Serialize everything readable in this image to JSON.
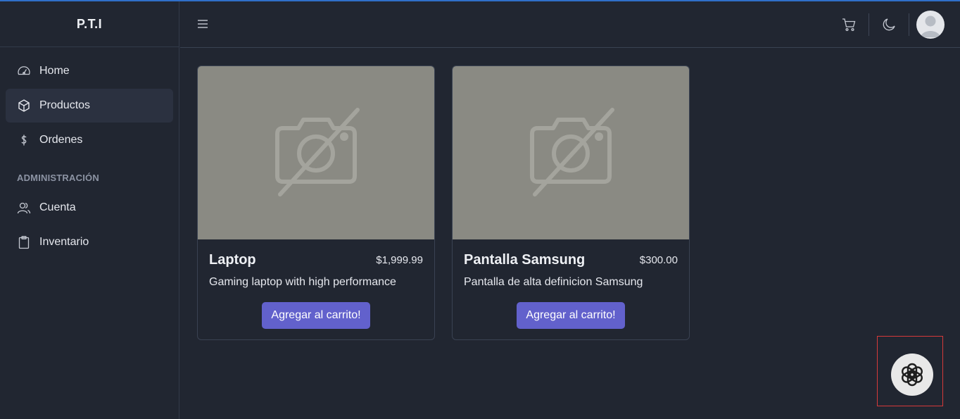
{
  "brand": "P.T.I",
  "sidebar": {
    "items": [
      {
        "label": "Home",
        "icon": "speedometer-icon"
      },
      {
        "label": "Productos",
        "icon": "cube-icon"
      },
      {
        "label": "Ordenes",
        "icon": "dollar-icon"
      }
    ],
    "section_title": "ADMINISTRACIÓN",
    "admin_items": [
      {
        "label": "Cuenta",
        "icon": "people-icon"
      },
      {
        "label": "Inventario",
        "icon": "clipboard-icon"
      }
    ],
    "active": "Productos"
  },
  "header": {
    "icons": [
      "hamburger-icon",
      "cart-icon",
      "moon-icon",
      "avatar"
    ]
  },
  "products": [
    {
      "name": "Laptop",
      "price": "$1,999.99",
      "description": "Gaming laptop with high performance",
      "button": "Agregar al carrito!"
    },
    {
      "name": "Pantalla Samsung",
      "price": "$300.00",
      "description": "Pantalla de alta definicion Samsung",
      "button": "Agregar al carrito!"
    }
  ],
  "colors": {
    "background": "#212631",
    "active_item": "#2b3140",
    "accent_button": "#6261cc",
    "image_placeholder": "#8a8a83",
    "highlight_border": "#d63a3a"
  },
  "floating": {
    "icon": "openai-icon"
  }
}
